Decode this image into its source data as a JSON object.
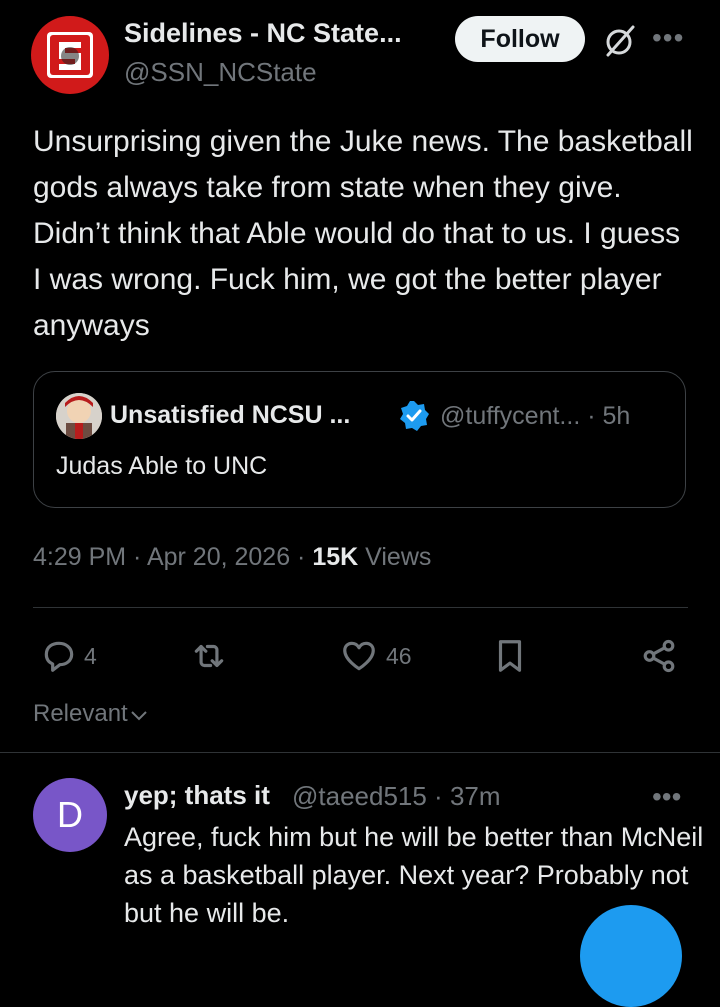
{
  "post": {
    "author_name": "Sidelines - NC State...",
    "author_handle": "@SSN_NCState",
    "follow_label": "Follow",
    "more_label": "•••",
    "text": "Unsurprising given the Juke news. The basketball gods always take from state when they give. Didn’t think that Able would do that to us. I guess I was wrong. Fuck him, we got the better player anyways",
    "avatar_letter": "S",
    "brand_color": "#d11a1a"
  },
  "quote": {
    "author_name": "Unsatisfied NCSU ...",
    "author_handle": "@tuffycent... · 5h",
    "text": "Judas Able to UNC",
    "verified_color": "#1d9bf0"
  },
  "meta": {
    "time": "4:29 PM · Apr 20, 2026 · ",
    "views_count": "15K",
    "views_label": " Views"
  },
  "actions": {
    "replies": "4",
    "reposts": "",
    "likes": "46"
  },
  "sort": {
    "label": "Relevant"
  },
  "reply": {
    "avatar_letter": "D",
    "avatar_color": "#7856c8",
    "author_name": "yep; thats it",
    "author_handle": "@taeed515 · 37m",
    "more_label": "•••",
    "text": "Agree, fuck him but he will be better than McNeil as a basketball player. Next year? Probably not but he will be."
  },
  "accent_color": "#1d9bf0"
}
